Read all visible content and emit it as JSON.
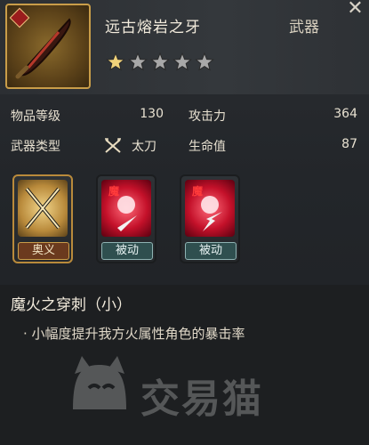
{
  "item": {
    "name": "远古熔岩之牙",
    "type": "武器",
    "rating": {
      "filled": 1,
      "total": 5
    }
  },
  "stats": {
    "left": [
      {
        "label": "物品等级",
        "value": "130"
      },
      {
        "label": "武器类型",
        "value": "太刀",
        "icon": "crossed-swords-icon"
      }
    ],
    "right": [
      {
        "label": "攻击力",
        "value": "364"
      },
      {
        "label": "生命值",
        "value": "87"
      }
    ]
  },
  "skills": [
    {
      "label": "奥义",
      "icon": "crossed-swords-icon"
    },
    {
      "label": "被动",
      "icon": "demon-fire-dagger-icon",
      "badge": "魔"
    },
    {
      "label": "被动",
      "icon": "demon-fire-break-icon",
      "badge": "魔"
    }
  ],
  "description": {
    "title": "魔火之穿刺（小）",
    "lines": [
      "· 小幅度提升我方火属性角色的暴击率"
    ]
  },
  "watermark": {
    "text": "交易猫"
  },
  "colors": {
    "gold": "#c99d49",
    "panel": "#2a2d31",
    "red": "#c4112a",
    "teal": "#2f4f4f"
  }
}
